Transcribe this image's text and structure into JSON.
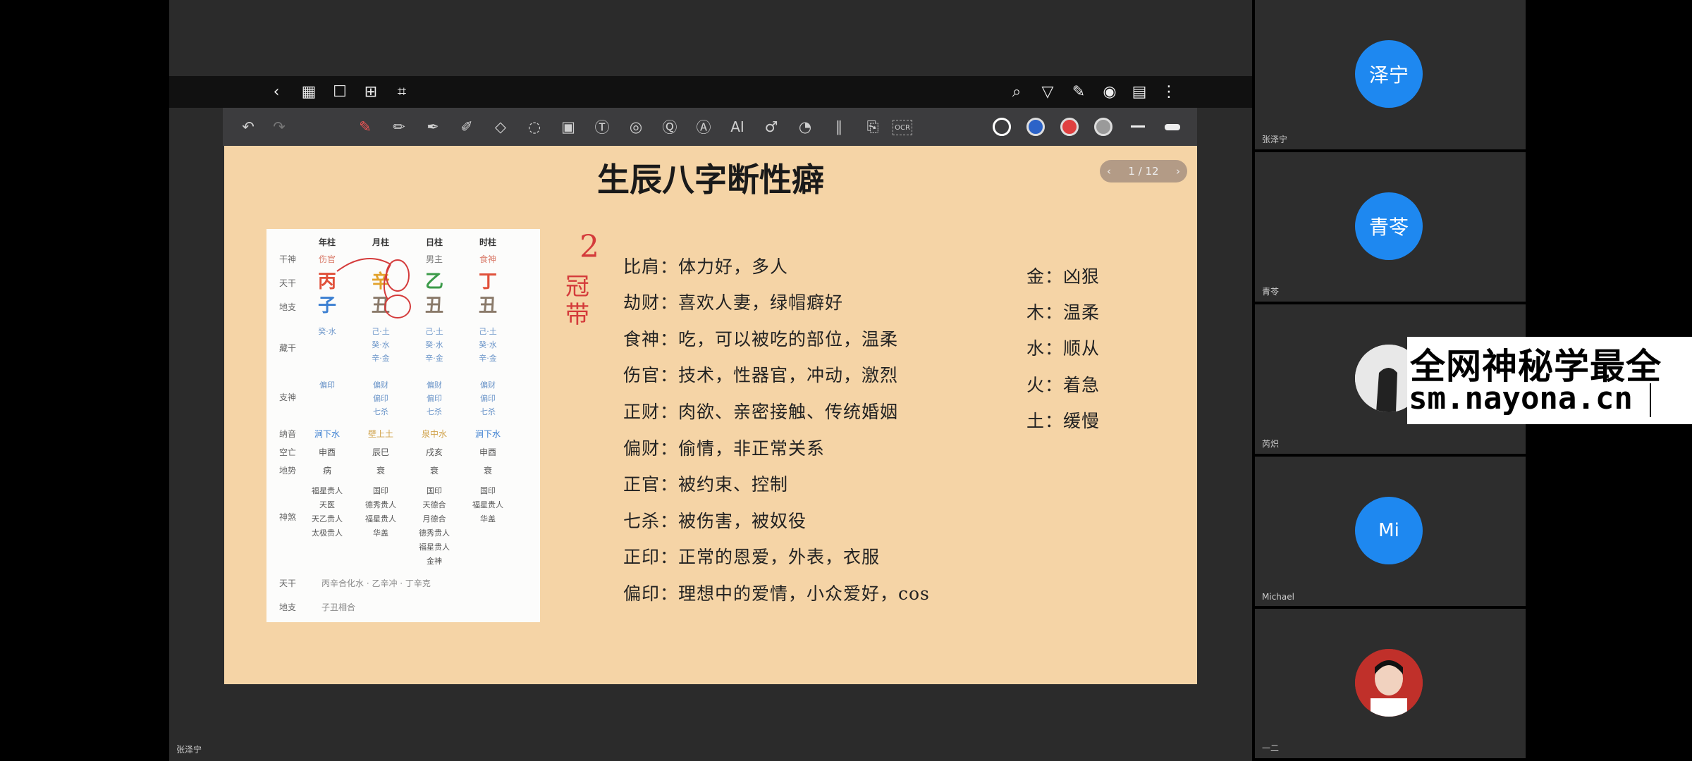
{
  "app_top": {
    "left_icons": [
      "back-icon",
      "grid-icon",
      "bookmark-icon",
      "add-page-icon",
      "crop-icon"
    ],
    "right_icons": [
      "search-icon",
      "shirt-icon",
      "pen-sign-icon",
      "eye-icon",
      "book-icon",
      "more-icon"
    ]
  },
  "toolbar": {
    "tools": [
      "undo-icon",
      "redo-icon",
      "pen-icon",
      "pencil-icon",
      "fountain-pen-icon",
      "highlighter-icon",
      "eraser-icon",
      "lasso-icon",
      "image-icon",
      "textbox-icon",
      "shapes-icon",
      "ocr-text-icon",
      "text-recognize-icon",
      "ai-icon",
      "mic-icon",
      "sticker-icon",
      "ruler-icon",
      "translate-icon",
      "ocr-icon"
    ],
    "ai_label": "AI",
    "ocr_label": "OCR",
    "colors": [
      "#ffffff",
      "#2c63c8",
      "#e04040",
      "#9a9a9a"
    ]
  },
  "slide": {
    "title": "生辰八字断性癖",
    "pager": "1 / 12",
    "card": {
      "headers": [
        "年柱",
        "月柱",
        "日柱",
        "时柱"
      ],
      "row_labels": [
        "干神",
        "天干",
        "地支",
        "藏干",
        "支神",
        "纳音",
        "空亡",
        "地势",
        "神煞",
        "天干",
        "地支"
      ],
      "gan_shen": [
        "伤官",
        "",
        "男主",
        "食神"
      ],
      "tian_gan": [
        "丙",
        "辛",
        "乙",
        "丁"
      ],
      "di_zhi": [
        "子",
        "丑",
        "丑",
        "丑"
      ],
      "cang_gan": [
        "癸·水",
        "己·土\n癸·水\n辛·金",
        "己·土\n癸·水\n辛·金",
        "己·土\n癸·水\n辛·金"
      ],
      "zhi_shen": [
        "偏印",
        "偏财\n偏印\n七杀",
        "偏财\n偏印\n七杀",
        "偏财\n偏印\n七杀"
      ],
      "na_yin": [
        "涧下水",
        "壁上土",
        "泉中水",
        "涧下水"
      ],
      "kong_wang": [
        "申酉",
        "辰巳",
        "戌亥",
        "申酉"
      ],
      "di_shi": [
        "病",
        "衰",
        "衰",
        "衰"
      ],
      "shen_sha": [
        "福星贵人\n天医\n天乙贵人\n太极贵人",
        "国印\n德秀贵人\n福星贵人\n华盖",
        "国印\n天德合\n月德合\n德秀贵人\n福星贵人\n金神",
        "国印\n福星贵人\n华盖"
      ],
      "tian_gan_rel": "丙辛合化水 · 乙辛冲 · 丁辛克",
      "di_zhi_rel": "子丑相合"
    },
    "lines": [
      "比肩：体力好，多人",
      "劫财：喜欢人妻，绿帽癖好",
      "食神：吃，可以被吃的部位，温柔",
      "伤官：技术，性器官，冲动，激烈",
      "正财：肉欲、亲密接触、传统婚姻",
      "偏财：偷情，非正常关系",
      "正官：被约束、控制",
      "七杀：被伤害，被奴役",
      "正印：正常的恩爱，外表，衣服",
      "偏印：理想中的爱情，小众爱好，cos"
    ],
    "elements": [
      "金：凶狠",
      "木：温柔",
      "水：顺从",
      "火：着急",
      "土：缓慢"
    ],
    "handwriting": [
      "2",
      "冠带"
    ]
  },
  "bottom_label": "张泽宁",
  "participants": [
    {
      "avatar_text": "泽宁",
      "name": "张泽宁"
    },
    {
      "avatar_text": "青苓",
      "name": "青苓"
    },
    {
      "avatar_text": "",
      "name": "芮炽"
    },
    {
      "avatar_text": "Mi",
      "name": "Michael"
    },
    {
      "avatar_text": "",
      "name": "一二"
    }
  ],
  "watermark": {
    "line1": "全网神秘学最全",
    "line2": "sm.nayona.cn"
  }
}
